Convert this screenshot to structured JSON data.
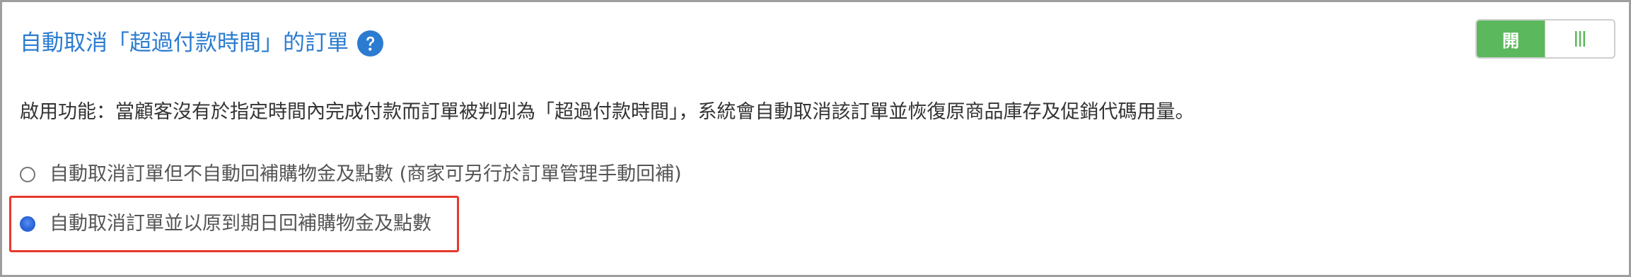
{
  "header": {
    "title": "自動取消「超過付款時間」的訂單",
    "help_icon": "question-circle-icon",
    "accent_color": "#2b7cd1"
  },
  "toggle": {
    "on_label": "開",
    "state": "on",
    "on_color": "#5cb85c",
    "handle_icon": "grip-lines-icon"
  },
  "description": "啟用功能：當顧客沒有於指定時間內完成付款而訂單被判別為「超過付款時間」，系統會自動取消該訂單並恢復原商品庫存及促銷代碼用量。",
  "options": [
    {
      "label": "自動取消訂單但不自動回補購物金及點數 (商家可另行於訂單管理手動回補)",
      "checked": false
    },
    {
      "label": "自動取消訂單並以原到期日回補購物金及點數",
      "checked": true
    }
  ],
  "highlight_color": "#e53a2b"
}
